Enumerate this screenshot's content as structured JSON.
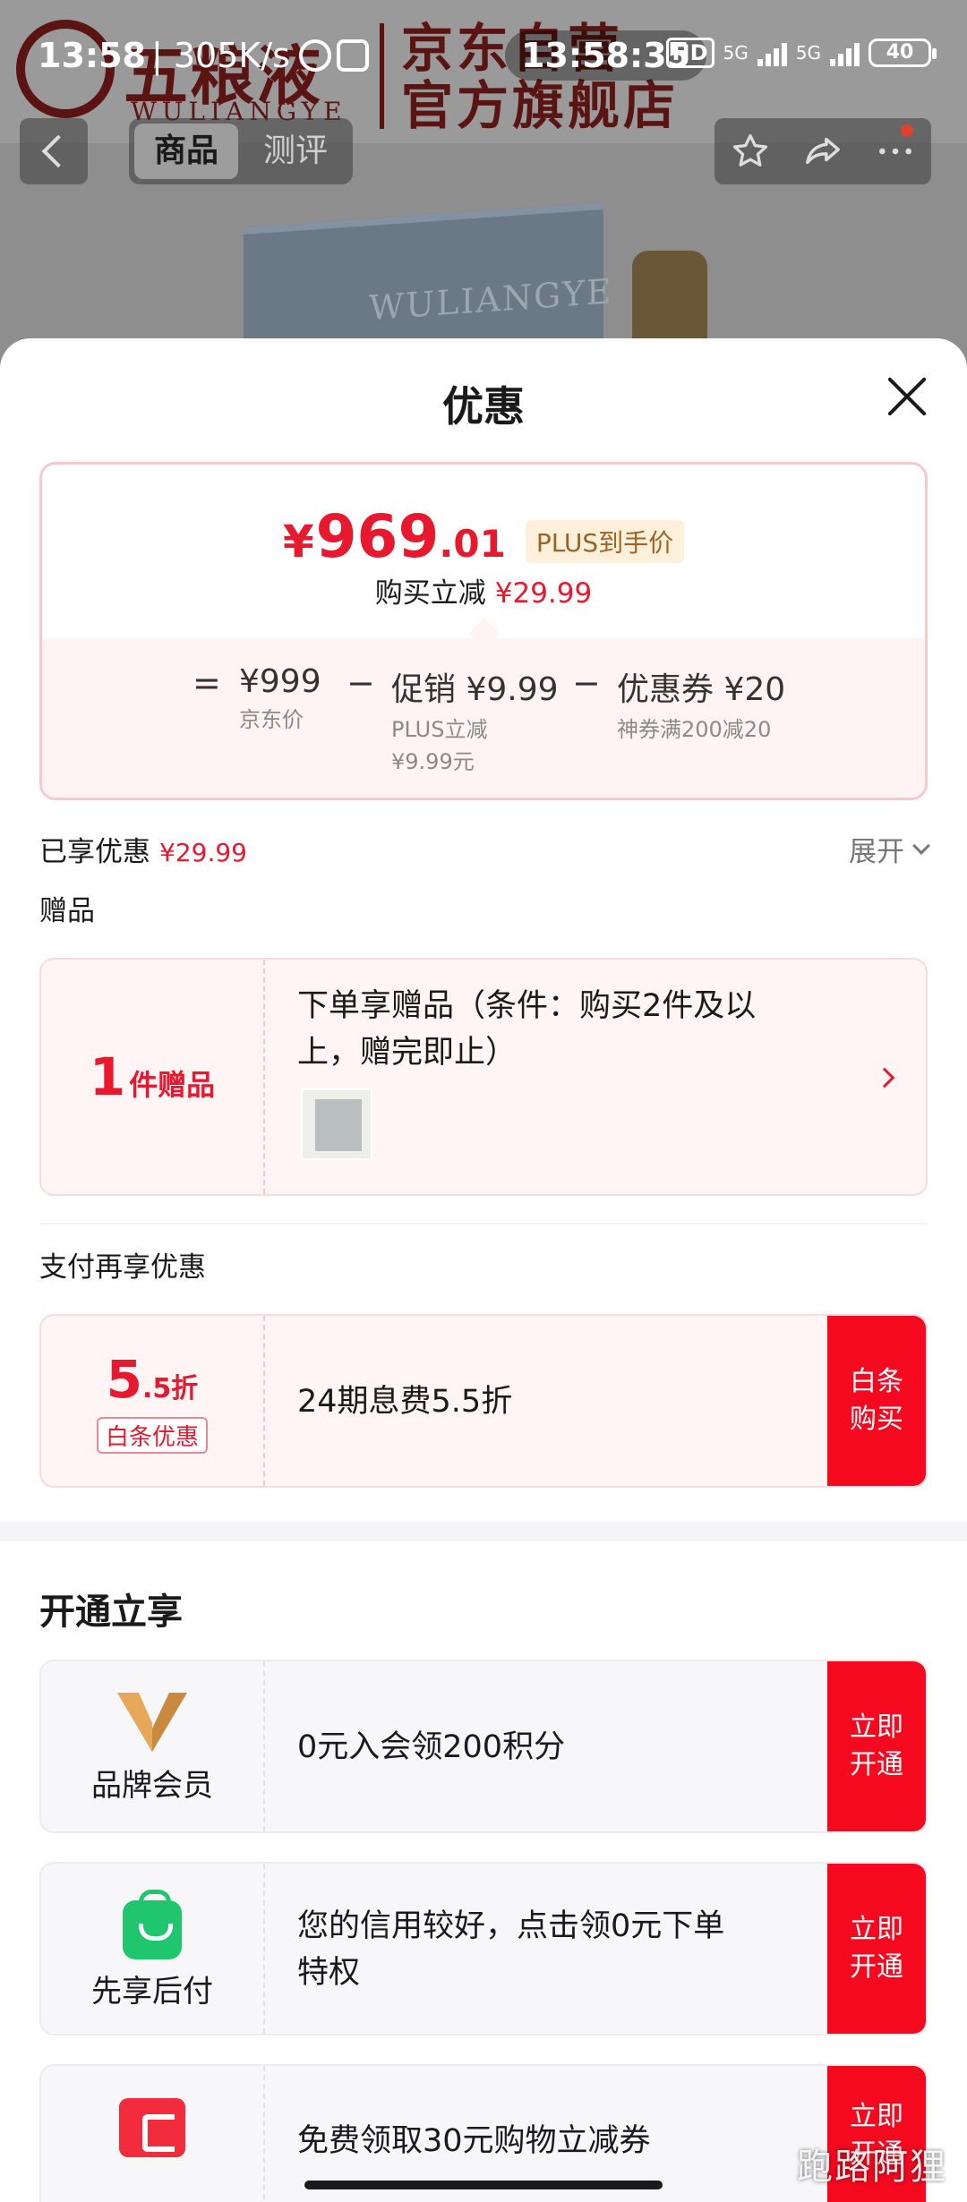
{
  "status_bar": {
    "time": "13:58",
    "speed": "| 305K/s",
    "center_time": "13:58:35",
    "hd": "HD",
    "net1": "5G",
    "net2": "5G",
    "battery": "40"
  },
  "store_banner": {
    "brand_cn": "五粮液",
    "brand_en": "WULIANGYE",
    "store_name": "京东自营\n官方旗舰店"
  },
  "nav": {
    "tabs": [
      {
        "label": "商品",
        "active": true
      },
      {
        "label": "测评",
        "active": false
      }
    ],
    "actions": [
      "star-icon",
      "share-icon",
      "more-icon"
    ]
  },
  "product_image": {
    "watermark": "WULIANGYE"
  },
  "sheet": {
    "title": "优惠",
    "price": {
      "currency": "¥",
      "integer": "969",
      "decimal": ".01",
      "tag": "PLUS到手价",
      "save_label": "购买立减",
      "save_value": "¥29.99"
    },
    "breakdown": {
      "eq": "=",
      "minus": "−",
      "jd_price": "¥999",
      "jd_price_label": "京东价",
      "promo": "促销 ¥9.99",
      "promo_label": "PLUS立减\n¥9.99元",
      "coupon": "优惠券 ¥20",
      "coupon_label": "神券满200减20"
    },
    "enjoyed": {
      "label": "已享优惠",
      "value": "¥29.99",
      "expand": "展开"
    },
    "gift_section": {
      "label": "赠品",
      "count": "1",
      "count_unit": "件赠品",
      "desc": "下单享赠品（条件：购买2件及以\n上，赠完即止）"
    },
    "pay_section": {
      "label": "支付再享优惠",
      "discount_num": "5",
      "discount_unit": ".5折",
      "discount_tag": "白条优惠",
      "desc": "24期息费5.5折",
      "action": "白条\n购买"
    },
    "open_section": {
      "title": "开通立享",
      "items": [
        {
          "name": "品牌会员",
          "icon": "brand-v-icon",
          "desc": "0元入会领200积分",
          "action": "立即\n开通"
        },
        {
          "name": "先享后付",
          "icon": "shopping-bag-icon",
          "desc": "您的信用较好，点击领0元下单\n特权",
          "action": "立即\n开通"
        },
        {
          "name": "",
          "icon": "card-icon",
          "desc": "免费领取30元购物立减券",
          "action": "立即\n开通"
        }
      ]
    }
  },
  "watermark": "跑路阿狸",
  "colors": {
    "accent": "#E8192F",
    "action_red": "#F4091F",
    "plus_gold": "#9E6322",
    "dim_overlay": "#8E8E8E"
  }
}
